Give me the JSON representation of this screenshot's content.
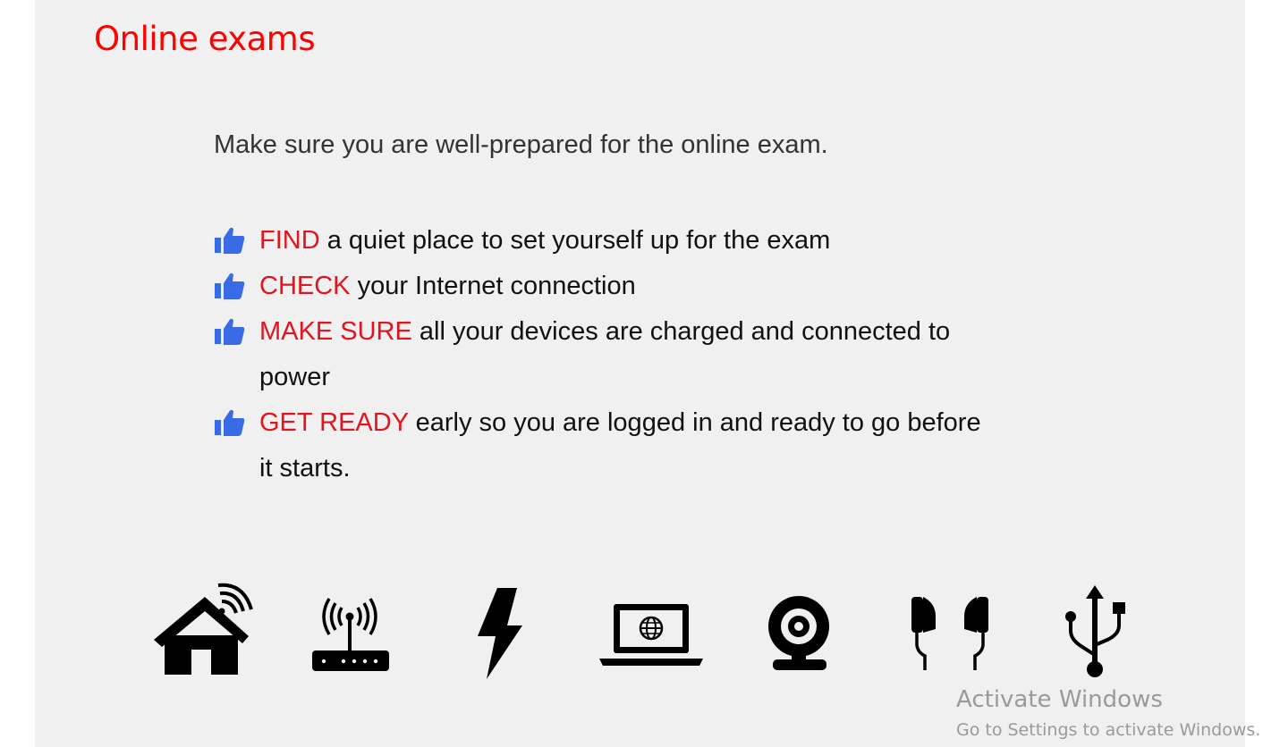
{
  "page": {
    "title": "Online exams",
    "intro": "Make sure you are well-prepared for the online exam.",
    "tips": [
      {
        "keyword": "FIND",
        "text": " a quiet place to set yourself up for the exam"
      },
      {
        "keyword": "CHECK",
        "text": " your Internet connection"
      },
      {
        "keyword": "MAKE SURE",
        "text": " all your devices are charged and connected to power"
      },
      {
        "keyword": "GET READY",
        "text": " early so you are logged in and ready to go before it starts."
      }
    ],
    "icons": [
      "home-wifi-icon",
      "router-icon",
      "lightning-icon",
      "laptop-globe-icon",
      "webcam-icon",
      "earphones-icon",
      "usb-icon"
    ]
  },
  "watermark": {
    "title": "Activate Windows",
    "subtitle": "Go to Settings to activate Windows."
  },
  "colors": {
    "title": "#ff0000",
    "keyword": "#e0151f",
    "thumb": "#3a6be6",
    "background": "#f0f0f0"
  }
}
